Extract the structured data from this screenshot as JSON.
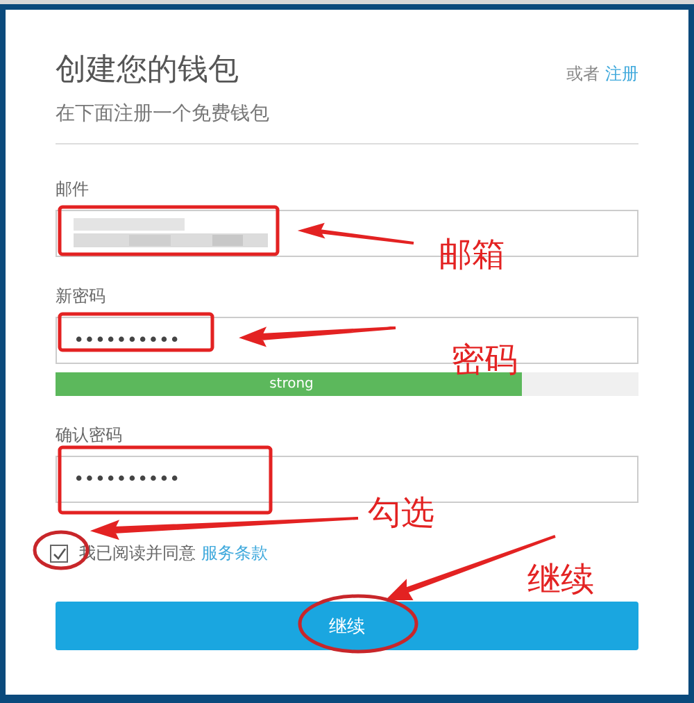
{
  "header": {
    "title": "创建您的钱包",
    "subtitle": "在下面注册一个免费钱包",
    "alt_prefix": "或者",
    "alt_link": "注册"
  },
  "fields": [
    {
      "kind": "blurred",
      "label": "邮件"
    },
    {
      "kind": "password",
      "label": "新密码",
      "value": "••••••••••",
      "strength": {
        "label": "strong",
        "level": 0.8
      }
    },
    {
      "kind": "password",
      "label": "确认密码",
      "value": "••••••••••"
    }
  ],
  "agreement": {
    "checked": true,
    "text": "我已阅读并同意",
    "link": "服务条款"
  },
  "button": "继续",
  "annotations": [
    {
      "text": "邮箱"
    },
    {
      "text": "密码"
    },
    {
      "text": "勾选"
    },
    {
      "text": "继续"
    }
  ]
}
